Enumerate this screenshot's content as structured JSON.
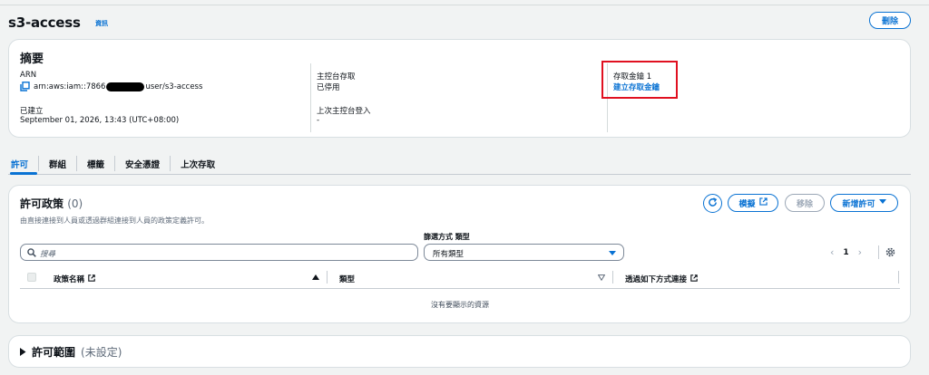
{
  "page": {
    "title": "s3-access",
    "info_link": "資訊",
    "delete_button": "刪除"
  },
  "summary": {
    "heading": "摘要",
    "arn_label": "ARN",
    "arn_prefix": "arn:aws:iam::7866",
    "arn_suffix": "user/s3-access",
    "created_label": "已建立",
    "created_value": "September 01, 2026, 13:43 (UTC+08:00)",
    "console_access_label": "主控台存取",
    "console_access_value": "已停用",
    "last_login_label": "上次主控台登入",
    "last_login_value": "-",
    "access_keys_label": "存取金鑰 1",
    "create_key_link": "建立存取金鑰"
  },
  "tabs": [
    "許可",
    "群組",
    "標籤",
    "安全憑證",
    "上次存取"
  ],
  "permissions": {
    "heading": "許可政策",
    "count": "(0)",
    "description": "由直接連接到人員或透過群組連接到人員的政策定義許可。",
    "simulate_button": "模擬",
    "remove_button": "移除",
    "add_button": "新增許可",
    "filter_label": "篩選方式 類型",
    "search_placeholder": "搜尋",
    "type_select_value": "所有類型",
    "page_number": "1",
    "columns": [
      "政策名稱",
      "類型",
      "透過如下方式連接"
    ],
    "empty_message": "沒有要顯示的資源"
  },
  "boundary": {
    "heading": "許可範圍",
    "status": "(未設定)"
  },
  "colors": {
    "accent": "#0972d3",
    "highlight": "#e01020"
  }
}
